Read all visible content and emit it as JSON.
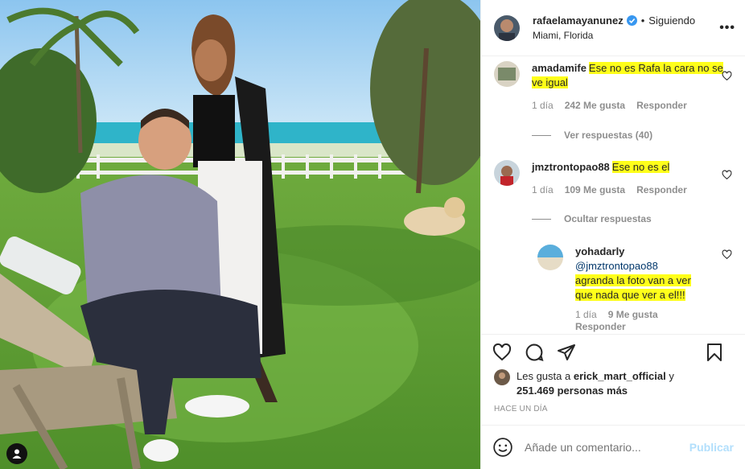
{
  "post": {
    "username": "rafaelamayanunez",
    "dot": "•",
    "follow_label": "Siguiendo",
    "location": "Miami, Florida",
    "more_label": "•••"
  },
  "comments": [
    {
      "username": "amadamife",
      "text": "Ese no es Rafa la cara no se ve igual",
      "time": "1 día",
      "likes": "242 Me gusta",
      "reply_label": "Responder",
      "replies_toggle": "Ver respuestas (40)"
    },
    {
      "username": "jmztrontopao88",
      "text": "Ese no es el",
      "time": "1 día",
      "likes": "109 Me gusta",
      "reply_label": "Responder",
      "replies_toggle": "Ocultar respuestas"
    }
  ],
  "reply": {
    "username": "yohadarly",
    "mention": "@jmztrontopao88",
    "text_line1": "agranda la foto van a ver",
    "text_line2": "que nada que ver a el!!!",
    "time": "1 día",
    "likes": "9 Me gusta",
    "reply_label": "Responder"
  },
  "likes_summary": {
    "prefix": "Les gusta a",
    "user": "erick_mart_official",
    "middle": "y",
    "count": "251.469 personas más"
  },
  "timestamp": "HACE UN DÍA",
  "add_comment": {
    "placeholder": "Añade un comentario...",
    "publish_label": "Publicar"
  },
  "colors": {
    "highlight": "#ffff1a",
    "link": "#00376b",
    "publish": "#b2dffc",
    "muted": "#8e8e8e"
  }
}
